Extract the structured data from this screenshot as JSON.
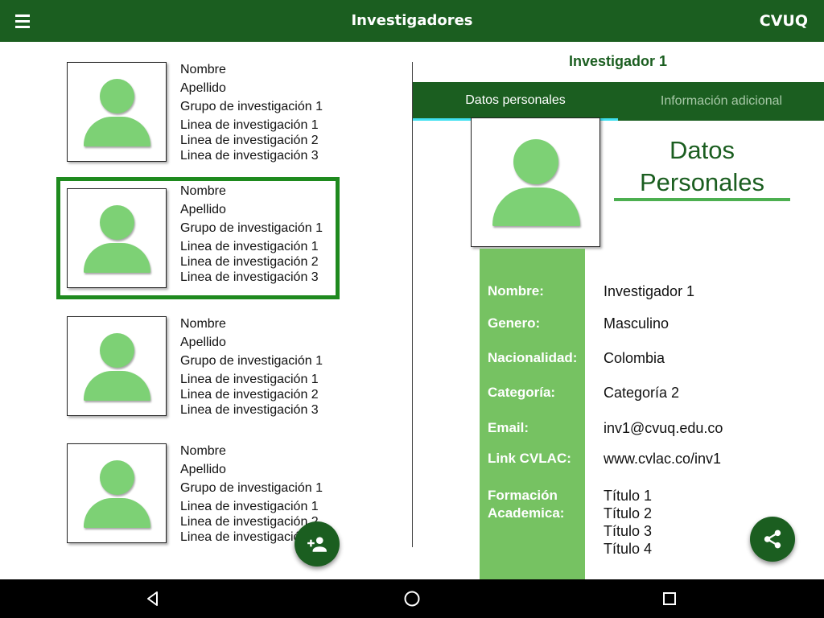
{
  "appbar": {
    "title": "Investigadores",
    "brand": "CVUQ",
    "menu_icon": "hamburger-menu-icon"
  },
  "list": {
    "cards": [
      {
        "lines": [
          "Nombre",
          "Apellido",
          "Grupo de investigación 1",
          "Linea de investigación 1",
          "Linea de investigación 2",
          "Linea de investigación 3"
        ],
        "selected": false
      },
      {
        "lines": [
          "Nombre",
          "Apellido",
          "Grupo de investigación 1",
          "Linea de investigación 1",
          "Linea de investigación 2",
          "Linea de investigación 3"
        ],
        "selected": true
      },
      {
        "lines": [
          "Nombre",
          "Apellido",
          "Grupo de investigación 1",
          "Linea de investigación 1",
          "Linea de investigación 2",
          "Linea de investigación 3"
        ],
        "selected": false
      },
      {
        "lines": [
          "Nombre",
          "Apellido",
          "Grupo de investigación 1",
          "Linea de investigación 1",
          "Linea de investigación 2",
          "Linea de investigación 3"
        ],
        "selected": false
      }
    ],
    "fab_icon": "add-person-icon"
  },
  "detail": {
    "title": "Investigador 1",
    "tabs": [
      {
        "label": "Datos personales",
        "active": true
      },
      {
        "label": "Información adicional",
        "active": false
      }
    ],
    "section_title": "Datos Personales",
    "fields": [
      {
        "label": "Nombre:",
        "value": "Investigador 1"
      },
      {
        "label": "Genero:",
        "value": "Masculino"
      },
      {
        "label": "Nacionalidad:",
        "value": "Colombia"
      },
      {
        "label": "Categoría:",
        "value": "Categoría 2"
      },
      {
        "label": "Email:",
        "value": "inv1@cvuq.edu.co"
      },
      {
        "label": "Link CVLAC:",
        "value": "www.cvlac.co/inv1"
      }
    ],
    "formacion": {
      "label_line1": "Formación",
      "label_line2": "Academica:",
      "values": [
        "Título 1",
        "Título 2",
        "Título 3",
        "Título 4"
      ]
    },
    "share_icon": "share-icon"
  },
  "navbar": {
    "icons": [
      "back-icon",
      "home-icon",
      "recents-icon"
    ]
  },
  "colors": {
    "primary": "#1b5e20",
    "avatar": "#7dd175",
    "label_column": "#76c262",
    "selected_border": "#1e8a1e",
    "tab_indicator": "#40e0f0"
  }
}
